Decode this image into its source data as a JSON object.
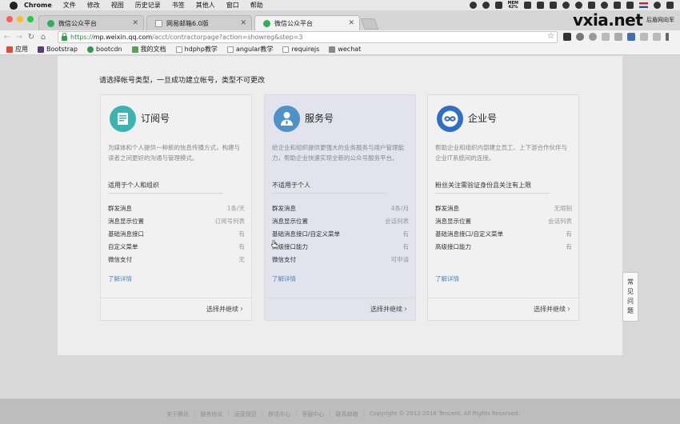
{
  "menubar": {
    "app": "Chrome",
    "items": [
      "文件",
      "修改",
      "视图",
      "历史记录",
      "书签",
      "其他人",
      "窗口",
      "帮助"
    ],
    "mem_label": "MEM",
    "mem_value": "42%"
  },
  "tabs": [
    {
      "title": "微信公众平台"
    },
    {
      "title": "网易邮箱6.0版"
    },
    {
      "title": "微信公众平台"
    }
  ],
  "watermark": "vxia.net",
  "profile": "后盾网向军",
  "address": {
    "secure": "https://",
    "host": "mp.weixin.qq.com",
    "path": "/acct/contractorpage?action=showreg&step=3"
  },
  "bookmarks": [
    "应用",
    "Bootstrap",
    "bootcdn",
    "我的文档",
    "hdphp教学",
    "angular教学",
    "requirejs",
    "wechat"
  ],
  "page": {
    "heading": "请选择帐号类型，一旦成功建立帐号，类型不可更改",
    "more_label": "了解详情",
    "cta_label": "选择并继续"
  },
  "cards": [
    {
      "name": "订阅号",
      "desc": "为媒体和个人提供一种新的信息传播方式，构建与读者之间更好的沟通与管理模式。",
      "suit": "适用于个人和组织",
      "features": [
        {
          "name": "群发消息",
          "value": "1条/天"
        },
        {
          "name": "消息显示位置",
          "value": "订阅号列表"
        },
        {
          "name": "基础消息接口",
          "value": "有"
        },
        {
          "name": "自定义菜单",
          "value": "有"
        },
        {
          "name": "微信支付",
          "value": "无"
        }
      ]
    },
    {
      "name": "服务号",
      "desc": "给企业和组织提供更强大的业务服务与用户管理能力，帮助企业快速实现全新的公众号服务平台。",
      "suit": "不适用于个人",
      "features": [
        {
          "name": "群发消息",
          "value": "4条/月"
        },
        {
          "name": "消息显示位置",
          "value": "会话列表"
        },
        {
          "name": "基础消息接口/自定义菜单",
          "value": "有"
        },
        {
          "name": "高级接口能力",
          "value": "有"
        },
        {
          "name": "微信支付",
          "value": "可申请"
        }
      ]
    },
    {
      "name": "企业号",
      "desc": "帮助企业和组织内部建立员工、上下游合作伙伴与企业IT系统间的连接。",
      "suit": "粉丝关注需验证身份且关注有上限",
      "features": [
        {
          "name": "群发消息",
          "value": "无限制"
        },
        {
          "name": "消息显示位置",
          "value": "会话列表"
        },
        {
          "name": "基础消息接口/自定义菜单",
          "value": "有"
        },
        {
          "name": "高级接口能力",
          "value": "有"
        }
      ]
    }
  ],
  "faq": [
    "常",
    "见",
    "问",
    "题"
  ],
  "footer": {
    "links": [
      "关于腾讯",
      "服务协议",
      "运营规范",
      "辟谣中心",
      "客服中心",
      "联系邮箱"
    ],
    "copyright": "Copyright © 2012-2016 Tencent. All Rights Reserved."
  },
  "colors": {
    "wechat_green": "#2ab25b",
    "link_blue": "#4a88c7",
    "subscription_icon": "#3bb3b0",
    "service_icon": "#4e92c8",
    "enterprise_icon": "#2f6fc6"
  }
}
